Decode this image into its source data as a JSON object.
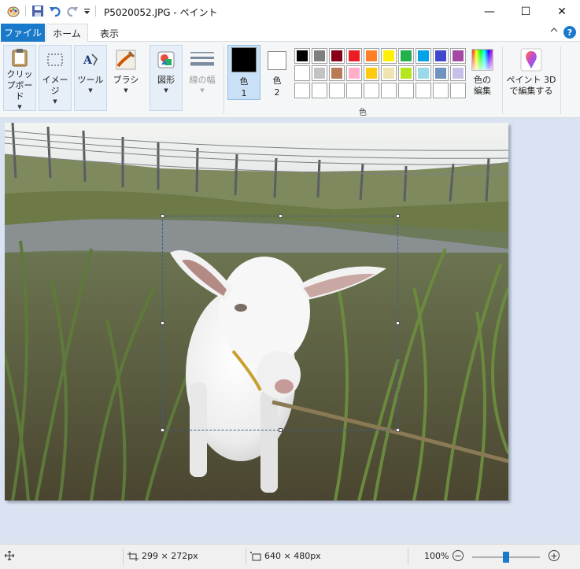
{
  "window": {
    "title": "P5020052.JPG - ペイント",
    "controls": {
      "minimize": "—",
      "maximize": "☐",
      "close": "✕"
    }
  },
  "tabs": {
    "file": "ファイル",
    "home": "ホーム",
    "view": "表示",
    "help": "?"
  },
  "ribbon": {
    "clipboard": "クリップボード",
    "image": "イメージ",
    "tools": "ツール",
    "brush": "ブラシ",
    "shapes": "図形",
    "line_width": "線の幅",
    "color1": "色\n1",
    "color1_name": "色",
    "color1_num": "1",
    "color2_name": "色",
    "color2_num": "2",
    "colors_group": "色",
    "edit_colors_line1": "色の",
    "edit_colors_line2": "編集",
    "paint3d_line1": "ペイント 3D",
    "paint3d_line2": "で編集する"
  },
  "palette": [
    "#000000",
    "#7f7f7f",
    "#880015",
    "#ed1c24",
    "#ff7f27",
    "#fff200",
    "#22b14c",
    "#00a2e8",
    "#3f48cc",
    "#a349a4",
    "#ffffff",
    "#c3c3c3",
    "#b97a57",
    "#ffaec9",
    "#ffc90e",
    "#efe4b0",
    "#b5e61d",
    "#99d9ea",
    "#7092be",
    "#c8bfe7"
  ],
  "colors": {
    "primary": "#000000",
    "secondary": "#ffffff",
    "accent": "#1979ca"
  },
  "status": {
    "selection_size": "299 × 272px",
    "image_size": "640 × 480px",
    "zoom": "100%",
    "zoom_level": 0.5
  }
}
